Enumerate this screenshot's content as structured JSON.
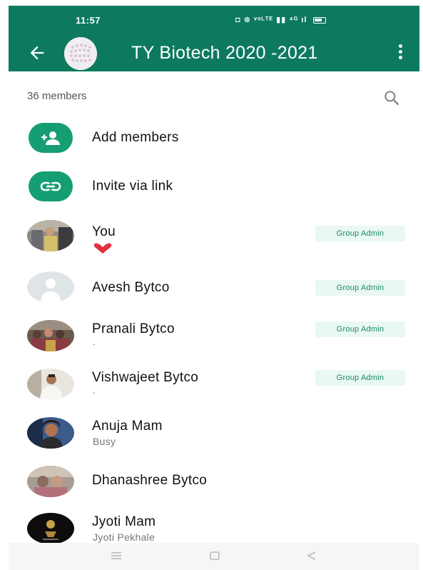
{
  "status_bar": {
    "time": "11:57",
    "indicators": "◘ ⊛ ᵛᵒᴸᵀᴱ ▮▮ ⁴ᴳ ıl"
  },
  "toolbar": {
    "title": "TY Biotech 2020 -2021",
    "back_icon": "arrow-back-icon",
    "menu_icon": "more-vert-icon"
  },
  "members_header": {
    "count_label": "36 members",
    "search_icon": "search-icon"
  },
  "actions": [
    {
      "label": "Add members",
      "icon": "add-person-icon"
    },
    {
      "label": "Invite via link",
      "icon": "link-icon"
    }
  ],
  "members": [
    {
      "name": "You",
      "about": "❤",
      "badge": "Group Admin"
    },
    {
      "name": "Avesh Bytco",
      "about": "",
      "badge": "Group Admin"
    },
    {
      "name": "Pranali Bytco",
      "about": ".",
      "badge": "Group Admin"
    },
    {
      "name": "Vishwajeet Bytco",
      "about": ".",
      "badge": "Group Admin"
    },
    {
      "name": "Anuja Mam",
      "about": "Busy",
      "badge": ""
    },
    {
      "name": "Dhanashree Bytco",
      "about": "",
      "badge": ""
    },
    {
      "name": "Jyoti Mam",
      "about": "Jyoti Pekhale",
      "badge": ""
    }
  ],
  "colors": {
    "appbar": "#0d7a5f",
    "accent": "#159e73",
    "badge_bg": "#e9f8f1",
    "badge_text": "#1a8a66"
  }
}
